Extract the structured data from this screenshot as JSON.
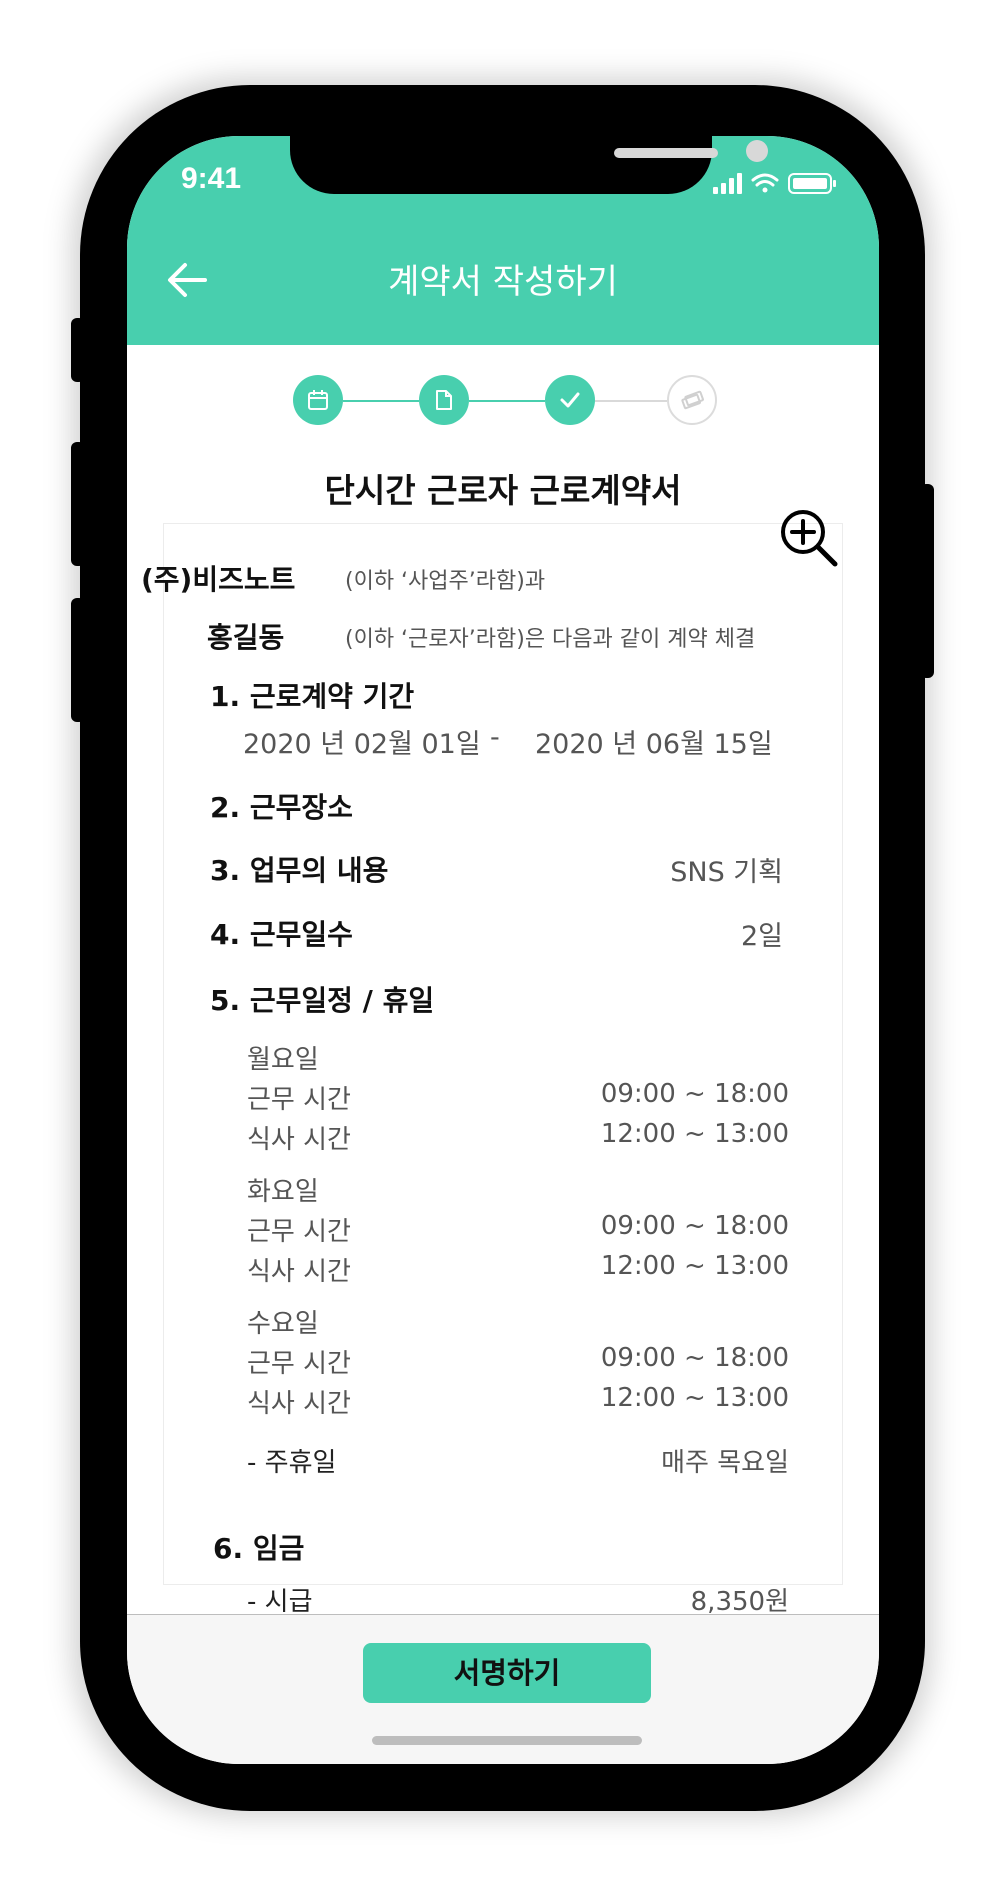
{
  "status": {
    "time": "9:41"
  },
  "header": {
    "title": "계약서 작성하기"
  },
  "document": {
    "title": "단시간 근로자 근로계약서",
    "employer": {
      "name": "(주)비즈노트",
      "note": "(이하 ‘사업주’라함)과"
    },
    "employee": {
      "name": "홍길동",
      "note": "(이하 ‘근로자’라함)은 다음과 같이 계약 체결"
    },
    "section1": {
      "title": "1. 근로계약 기간",
      "start": "2020 년 02월 01일",
      "separator": "-",
      "end": "2020 년 06월 15일"
    },
    "section2": {
      "title": "2. 근무장소"
    },
    "section3": {
      "title": "3. 업무의 내용",
      "value": "SNS 기획"
    },
    "section4": {
      "title": "4. 근무일수",
      "value": "2일"
    },
    "section5": {
      "title": "5. 근무일정 / 휴일",
      "days": [
        {
          "day": "월요일",
          "work_label": "근무 시간",
          "work": "09:00 ~ 18:00",
          "meal_label": "식사 시간",
          "meal": "12:00 ~ 13:00"
        },
        {
          "day": "화요일",
          "work_label": "근무 시간",
          "work": "09:00 ~ 18:00",
          "meal_label": "식사 시간",
          "meal": "12:00 ~ 13:00"
        },
        {
          "day": "수요일",
          "work_label": "근무 시간",
          "work": "09:00 ~ 18:00",
          "meal_label": "식사 시간",
          "meal": "12:00 ~ 13:00"
        }
      ],
      "holiday_label": "- 주휴일",
      "holiday_value": "매주 목요일"
    },
    "section6": {
      "title": "6. 임금",
      "wage_label": "- 시급",
      "wage_value": "8,350원"
    }
  },
  "footer": {
    "sign_label": "서명하기"
  },
  "colors": {
    "accent": "#48cfae",
    "inactive": "#dcdcdc"
  },
  "icons": {
    "back": "arrow-left-icon",
    "zoom": "zoom-in-icon",
    "steps": [
      "calendar-icon",
      "document-icon",
      "check-icon",
      "money-icon"
    ]
  }
}
